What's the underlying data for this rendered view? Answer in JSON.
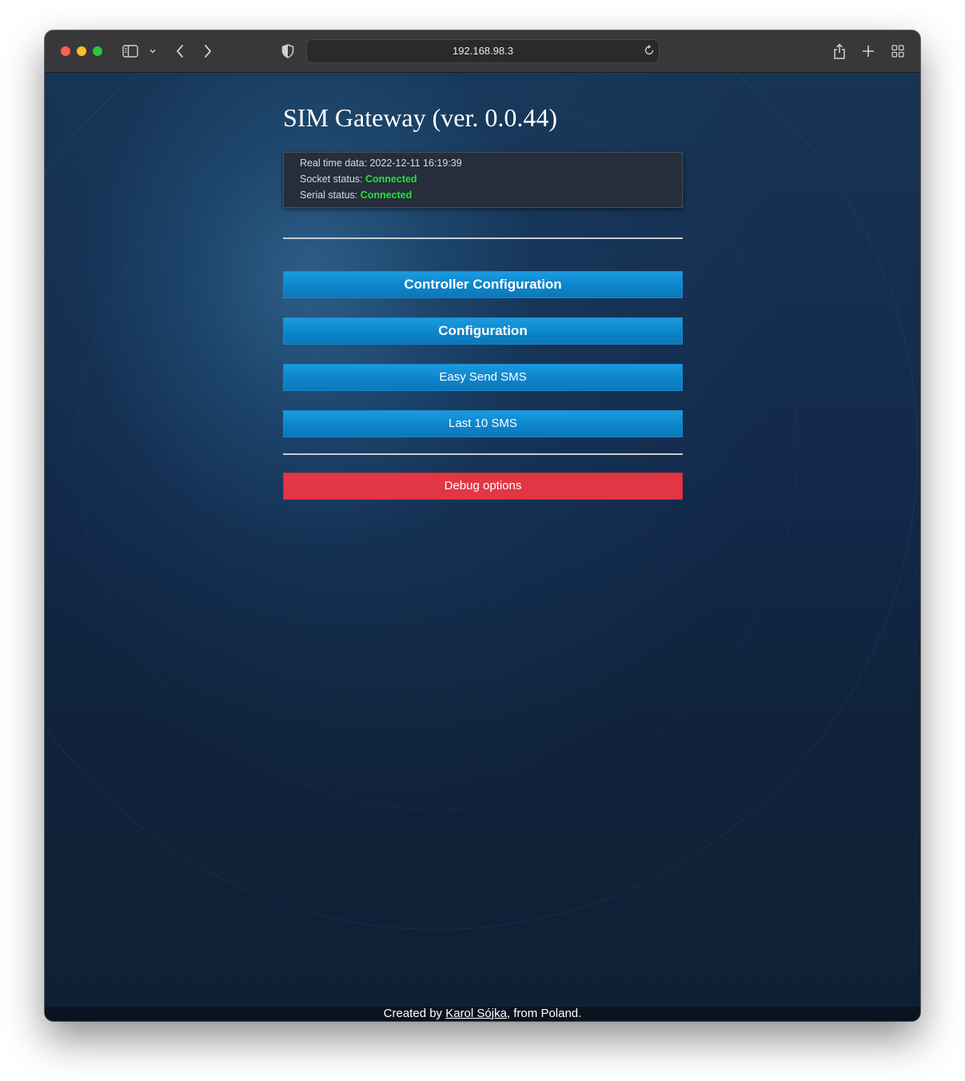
{
  "browser": {
    "url": "192.168.98.3",
    "icons": {
      "sidebar": "sidebar-icon",
      "chevron": "chevron-down-icon",
      "back": "back-arrow-icon",
      "forward": "forward-arrow-icon",
      "privacy": "shield-icon",
      "reload": "reload-icon",
      "share": "share-icon",
      "new_tab": "plus-icon",
      "tabs": "tab-overview-icon"
    }
  },
  "page": {
    "title": "SIM Gateway (ver. 0.0.44)",
    "status": {
      "realtime_label": "Real time data: ",
      "realtime_value": "2022-12-11 16:19:39",
      "socket_label": "Socket status: ",
      "socket_value": "Connected",
      "serial_label": "Serial status: ",
      "serial_value": "Connected",
      "ok_color": "#22e33a"
    },
    "buttons": {
      "controller_config": "Controller Configuration",
      "configuration": "Configuration",
      "easy_send_sms": "Easy Send SMS",
      "last_10_sms": "Last 10 SMS",
      "debug_options": "Debug options"
    },
    "colors": {
      "primary_button": "#0d85cb",
      "danger_button": "#e23644"
    },
    "footer": {
      "prefix": "Created by ",
      "author": "Karol Sójka",
      "suffix": ", from Poland."
    }
  }
}
